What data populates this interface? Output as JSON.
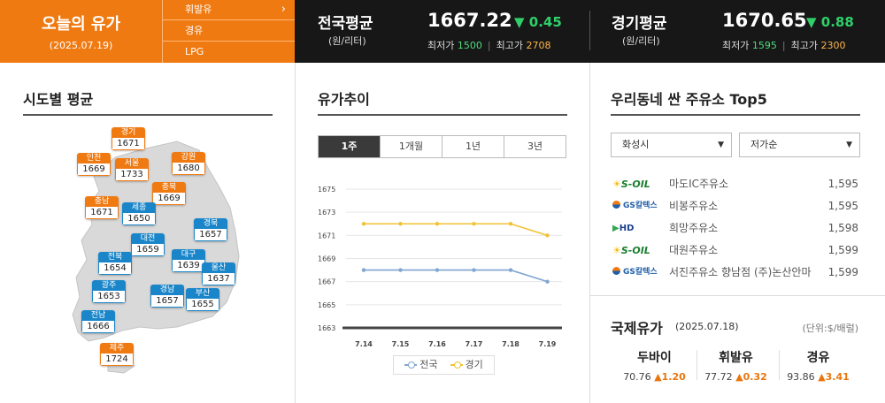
{
  "today": {
    "title": "오늘의 유가",
    "date": "(2025.07.19)"
  },
  "fuel_menu": [
    {
      "label": "휘발유",
      "chevron": "chevron-right-icon"
    },
    {
      "label": "경유"
    },
    {
      "label": "LPG"
    }
  ],
  "national": {
    "name": "전국평균",
    "unit": "(원/리터)",
    "price": "1667.22",
    "change": "▼ 0.45",
    "min_label": "최저가",
    "min": "1500",
    "max_label": "최고가",
    "max": "2708"
  },
  "gyeonggi": {
    "name": "경기평균",
    "unit": "(원/리터)",
    "price": "1670.65",
    "change": "▼ 0.88",
    "min_label": "최저가",
    "min": "1595",
    "max_label": "최고가",
    "max": "2300"
  },
  "regional": {
    "title": "시도별 평균",
    "regions": [
      {
        "name": "경기",
        "value": "1671",
        "color": "orange"
      },
      {
        "name": "인천",
        "value": "1669",
        "color": "orange"
      },
      {
        "name": "서울",
        "value": "1733",
        "color": "orange"
      },
      {
        "name": "강원",
        "value": "1680",
        "color": "orange"
      },
      {
        "name": "충북",
        "value": "1669",
        "color": "orange"
      },
      {
        "name": "충남",
        "value": "1671",
        "color": "orange"
      },
      {
        "name": "세종",
        "value": "1650",
        "color": "blue"
      },
      {
        "name": "경북",
        "value": "1657",
        "color": "blue"
      },
      {
        "name": "대전",
        "value": "1659",
        "color": "blue"
      },
      {
        "name": "전북",
        "value": "1654",
        "color": "blue"
      },
      {
        "name": "대구",
        "value": "1639",
        "color": "blue"
      },
      {
        "name": "울산",
        "value": "1637",
        "color": "blue"
      },
      {
        "name": "광주",
        "value": "1653",
        "color": "blue"
      },
      {
        "name": "경남",
        "value": "1657",
        "color": "blue"
      },
      {
        "name": "부산",
        "value": "1655",
        "color": "blue"
      },
      {
        "name": "전남",
        "value": "1666",
        "color": "blue"
      },
      {
        "name": "제주",
        "value": "1724",
        "color": "orange"
      }
    ]
  },
  "trend": {
    "title": "유가추이",
    "tabs": [
      "1주",
      "1개월",
      "1년",
      "3년"
    ],
    "active_tab": "1주"
  },
  "chart_data": {
    "type": "line",
    "title": "",
    "x": [
      "7.14",
      "7.15",
      "7.16",
      "7.17",
      "7.18",
      "7.19"
    ],
    "ylim": [
      1663,
      1675
    ],
    "yticks": [
      1663,
      1665,
      1667,
      1669,
      1671,
      1673,
      1675
    ],
    "grid": true,
    "legend": "bottom",
    "series": [
      {
        "name": "전국",
        "color": "#7fa5d0",
        "values": [
          1668,
          1668,
          1668,
          1668,
          1668,
          1667
        ]
      },
      {
        "name": "경기",
        "color": "#f1c233",
        "values": [
          1672,
          1672,
          1672,
          1672,
          1672,
          1671
        ]
      }
    ]
  },
  "top5": {
    "title": "우리동네 싼 주유소 Top5",
    "region_select": "화성시",
    "sort_select": "저가순",
    "stations": [
      {
        "brand": "S-OIL",
        "logo": "soil",
        "name": "마도IC주유소",
        "price": "1,595"
      },
      {
        "brand": "GS칼텍스",
        "logo": "gs",
        "name": "비봉주유소",
        "price": "1,595"
      },
      {
        "brand": "HD",
        "logo": "hd",
        "name": "희망주유소",
        "price": "1,598"
      },
      {
        "brand": "S-OIL",
        "logo": "soil",
        "name": "대원주유소",
        "price": "1,599"
      },
      {
        "brand": "GS칼텍스",
        "logo": "gs",
        "name": "서진주유소 향남점 (주)논산안마",
        "price": "1,599"
      }
    ]
  },
  "intl": {
    "title": "국제유가",
    "date": "(2025.07.18)",
    "unit": "(단위:$/배럴)",
    "items": [
      {
        "name": "두바이",
        "value": "70.76",
        "change": "▲1.20"
      },
      {
        "name": "휘발유",
        "value": "77.72",
        "change": "▲0.32"
      },
      {
        "name": "경유",
        "value": "93.86",
        "change": "▲3.41"
      }
    ]
  }
}
